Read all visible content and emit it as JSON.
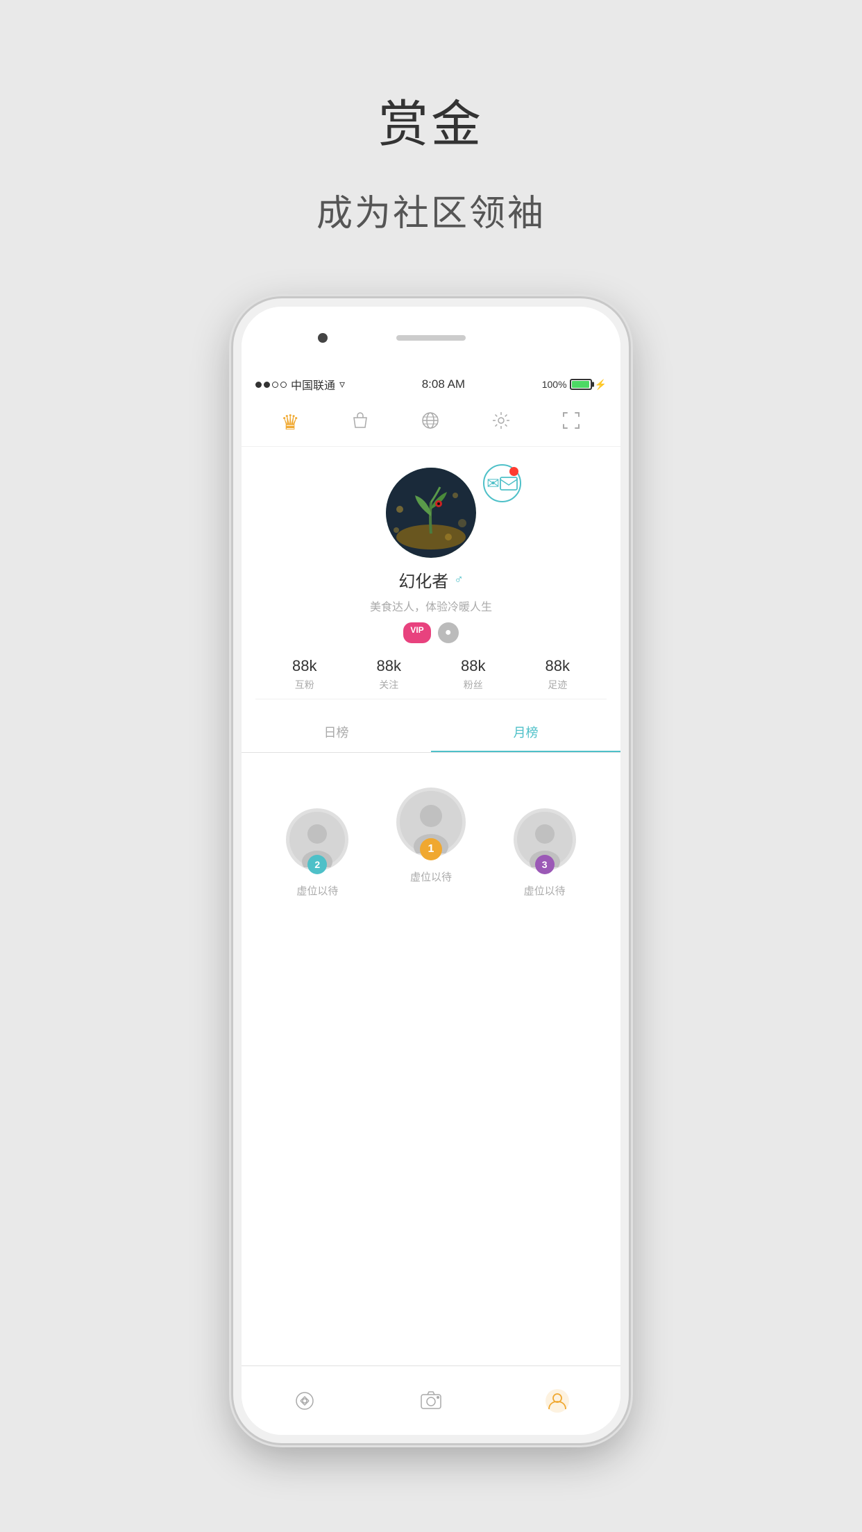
{
  "page": {
    "background_color": "#e9e9e9"
  },
  "header": {
    "title": "赏金",
    "subtitle": "成为社区领袖"
  },
  "status_bar": {
    "carrier": "中国联通",
    "time": "8:08 AM",
    "battery": "100%",
    "signal_filled": 2,
    "signal_empty": 2
  },
  "nav_icons": [
    {
      "name": "crown",
      "label": "crown-icon",
      "symbol": "♛",
      "active": true
    },
    {
      "name": "bag",
      "label": "bag-icon",
      "symbol": "👜"
    },
    {
      "name": "globe",
      "label": "globe-icon",
      "symbol": "🌐"
    },
    {
      "name": "settings",
      "label": "settings-icon",
      "symbol": "⚙"
    },
    {
      "name": "scan",
      "label": "scan-icon",
      "symbol": "⊡"
    }
  ],
  "profile": {
    "username": "幻化者",
    "bio": "美食达人，体验冷暖人生",
    "gender_icon": "♂",
    "badges": [
      "VIP",
      "●"
    ],
    "stats": [
      {
        "value": "88k",
        "label": "互粉"
      },
      {
        "value": "88k",
        "label": "关注"
      },
      {
        "value": "88k",
        "label": "粉丝"
      },
      {
        "value": "88k",
        "label": "足迹"
      }
    ]
  },
  "tabs": [
    {
      "label": "日榜",
      "active": false
    },
    {
      "label": "月榜",
      "active": true
    }
  ],
  "rankings": [
    {
      "rank": 2,
      "name": "虚位以待",
      "rank_color": "#4ec0c8",
      "position": "left"
    },
    {
      "rank": 1,
      "name": "虚位以待",
      "rank_color": "#f0a830",
      "position": "center"
    },
    {
      "rank": 3,
      "name": "虚位以待",
      "rank_color": "#9b59b6",
      "position": "right"
    }
  ],
  "bottom_nav": [
    {
      "name": "home",
      "symbol": "⊹",
      "active": false,
      "label": "home-icon"
    },
    {
      "name": "camera",
      "symbol": "◎",
      "active": false,
      "label": "camera-icon"
    },
    {
      "name": "profile",
      "symbol": "👤",
      "active": true,
      "label": "profile-icon"
    }
  ]
}
